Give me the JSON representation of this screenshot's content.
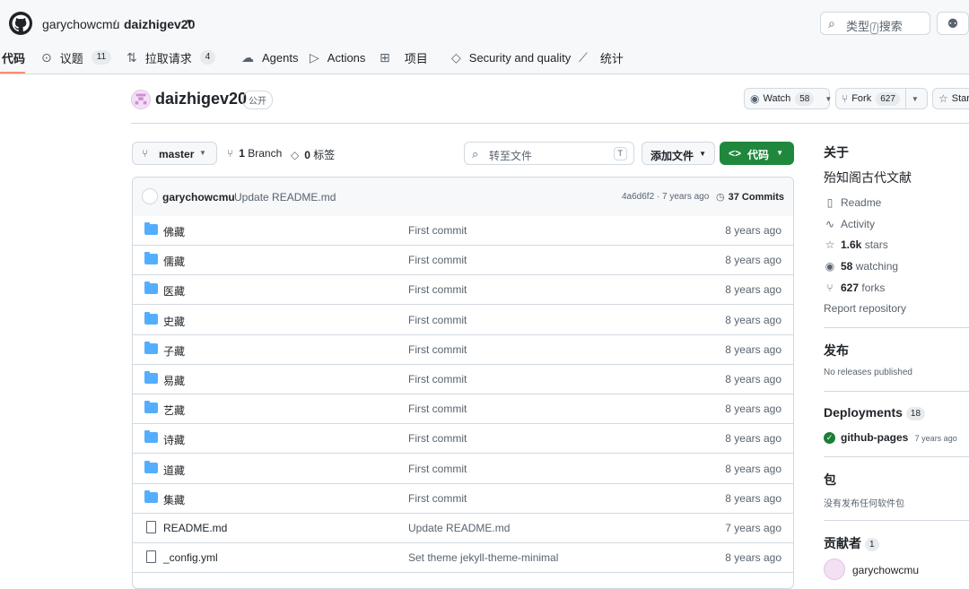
{
  "header": {
    "owner": "garychowcmu",
    "separator": "/",
    "repo": "daizhigev20",
    "search_prefix": "类型",
    "search_key": "/",
    "search_suffix": "搜索"
  },
  "tabs": [
    {
      "label": "代码",
      "icon": "code-icon",
      "count": ""
    },
    {
      "label": "议题",
      "icon": "issue-icon",
      "count": "11"
    },
    {
      "label": "拉取请求",
      "icon": "pull-request-icon",
      "count": "4"
    },
    {
      "label": "Agents",
      "icon": "agents-icon",
      "count": ""
    },
    {
      "label": "Actions",
      "icon": "play-icon",
      "count": ""
    },
    {
      "label": "项目",
      "icon": "table-icon",
      "count": ""
    },
    {
      "label": "Security and quality",
      "icon": "shield-icon",
      "count": ""
    },
    {
      "label": "统计",
      "icon": "graph-icon",
      "count": ""
    }
  ],
  "repo_header": {
    "title": "daizhigev20",
    "visibility": "公开",
    "watch_label": "Watch",
    "watch_count": "58",
    "fork_label": "Fork",
    "fork_count": "627",
    "star_label": "Star"
  },
  "toolbar": {
    "branch": "master",
    "branch_count": "1",
    "branch_label": "Branch",
    "tag_count": "0",
    "tag_label": "标签",
    "goto_placeholder": "转至文件",
    "goto_key": "T",
    "add_file": "添加文件",
    "code_button": "代码",
    "code_icon_text": "<>"
  },
  "latest_commit": {
    "author": "garychowcmu",
    "message": "Update README.md",
    "sha_age": "4a6d6f2 · 7 years ago",
    "commits_count": "37",
    "commits_label": "Commits"
  },
  "files": [
    {
      "name": "佛藏",
      "type": "dir",
      "message": "First commit",
      "age": "8 years ago"
    },
    {
      "name": "儒藏",
      "type": "dir",
      "message": "First commit",
      "age": "8 years ago"
    },
    {
      "name": "医藏",
      "type": "dir",
      "message": "First commit",
      "age": "8 years ago"
    },
    {
      "name": "史藏",
      "type": "dir",
      "message": "First commit",
      "age": "8 years ago"
    },
    {
      "name": "子藏",
      "type": "dir",
      "message": "First commit",
      "age": "8 years ago"
    },
    {
      "name": "易藏",
      "type": "dir",
      "message": "First commit",
      "age": "8 years ago"
    },
    {
      "name": "艺藏",
      "type": "dir",
      "message": "First commit",
      "age": "8 years ago"
    },
    {
      "name": "诗藏",
      "type": "dir",
      "message": "First commit",
      "age": "8 years ago"
    },
    {
      "name": "道藏",
      "type": "dir",
      "message": "First commit",
      "age": "8 years ago"
    },
    {
      "name": "集藏",
      "type": "dir",
      "message": "First commit",
      "age": "8 years ago"
    },
    {
      "name": "README.md",
      "type": "file",
      "message": "Update README.md",
      "age": "7 years ago"
    },
    {
      "name": "_config.yml",
      "type": "file",
      "message": "Set theme jekyll-theme-minimal",
      "age": "8 years ago"
    }
  ],
  "sidebar": {
    "about_heading": "关于",
    "description": "殆知阁古代文献",
    "readme": "Readme",
    "activity": "Activity",
    "stars_count": "1.6k",
    "stars_label": "stars",
    "watching_count": "58",
    "watching_label": "watching",
    "forks_count": "627",
    "forks_label": "forks",
    "report": "Report repository",
    "releases_heading": "发布",
    "releases_empty": "No releases published",
    "deployments_heading": "Deployments",
    "deployments_count": "18",
    "deployment_name": "github-pages",
    "deployment_age": "7 years ago",
    "packages_heading": "包",
    "packages_empty": "没有发布任何软件包",
    "contributors_heading": "贡献者",
    "contributors_count": "1",
    "contributor_name": "garychowcmu"
  },
  "colors": {
    "accent_green": "#1f883d",
    "folder_blue": "#54aeff",
    "tab_underline": "#fd8c73"
  }
}
